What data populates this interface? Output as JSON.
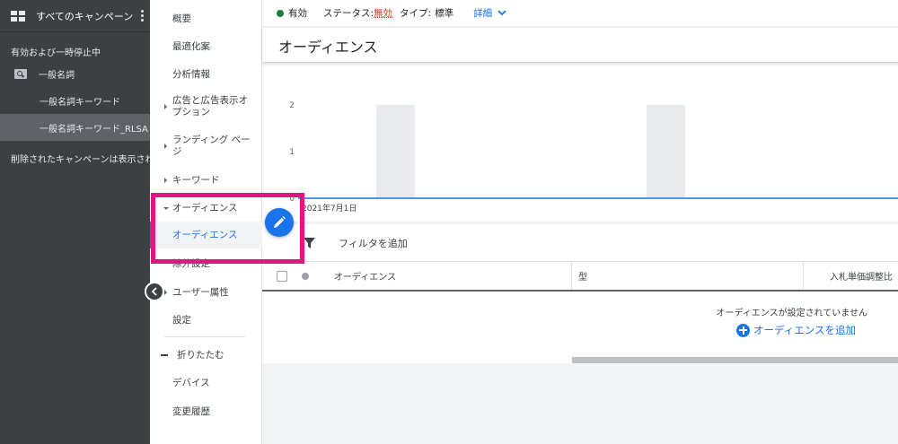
{
  "campaign_panel": {
    "title": "すべてのキャンペーン",
    "section_label": "有効および一時停止中",
    "ad_group": "一般名詞",
    "campaigns": [
      "一般名詞キーワード",
      "一般名詞キーワード_RLSA"
    ],
    "removed_note": "削除されたキャンペーンは表示されません"
  },
  "nav": {
    "overview": "概要",
    "recommendations": "最適化案",
    "insights": "分析情報",
    "ads_extensions": [
      "広告と広告表示オ",
      "プション"
    ],
    "landing_pages": [
      "ランディング ペー",
      "ジ"
    ],
    "keywords": "キーワード",
    "audiences_group": "オーディエンス",
    "audiences": "オーディエンス",
    "exclusions": "除外設定",
    "user_attributes": "ユーザー属性",
    "settings": "設定",
    "collapse": "折りたたむ",
    "devices": "デバイス",
    "change_history": "変更履歴"
  },
  "status_bar": {
    "enabled": "有効",
    "status_label": "ステータス:",
    "status_value": "無効",
    "type_label": "タイプ:",
    "type_value": "標準",
    "details": "詳細"
  },
  "page_title": "オーディエンス",
  "chart_data": {
    "type": "bar",
    "y_ticks": [
      "2",
      "1",
      "0"
    ],
    "ylim": [
      0,
      2
    ],
    "x_label_start": "2021年7月1日",
    "grid": false,
    "note": ""
  },
  "table": {
    "filter_label": "フィルタを追加",
    "columns": [
      "オーディエンス",
      "型",
      "入札単価調整比"
    ],
    "empty_message": "オーディエンスが設定されていません",
    "add_button": "オーディエンスを追加"
  },
  "colors": {
    "accent": "#1a73e8",
    "highlight": "#e0177f",
    "enabled": "#188038",
    "invalid": "#d93025"
  }
}
